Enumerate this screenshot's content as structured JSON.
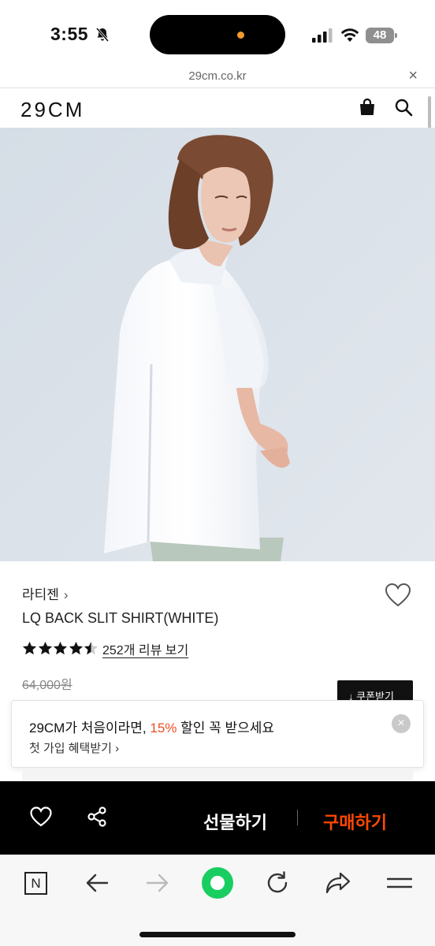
{
  "status_bar": {
    "time": "3:55",
    "battery": "48"
  },
  "browser": {
    "url": "29cm.co.kr",
    "close_symbol": "×"
  },
  "header": {
    "logo": "29CM"
  },
  "product": {
    "brand": "라티젠",
    "brand_chevron": "›",
    "name": "LQ BACK SLIT SHIRT(WHITE)",
    "rating": 4.5,
    "review_link": "252개 리뷰 보기",
    "original_price": "64,000원",
    "coupon_button": "↓ 쿠폰받기"
  },
  "toast": {
    "line1_prefix": "29CM가 처음이라면, ",
    "line1_percent": "15%",
    "line1_suffix": " 할인 꼭 받으세요",
    "line2": "첫 가입 혜택받기 ›",
    "close_symbol": "×"
  },
  "buy_bar": {
    "gift_label": "선물하기",
    "buy_label": "구매하기"
  },
  "bottom_nav": {
    "n_label": "N"
  },
  "colors": {
    "accent_orange": "#ff4800",
    "toast_percent": "#ef4e23",
    "green": "#19ce60"
  }
}
